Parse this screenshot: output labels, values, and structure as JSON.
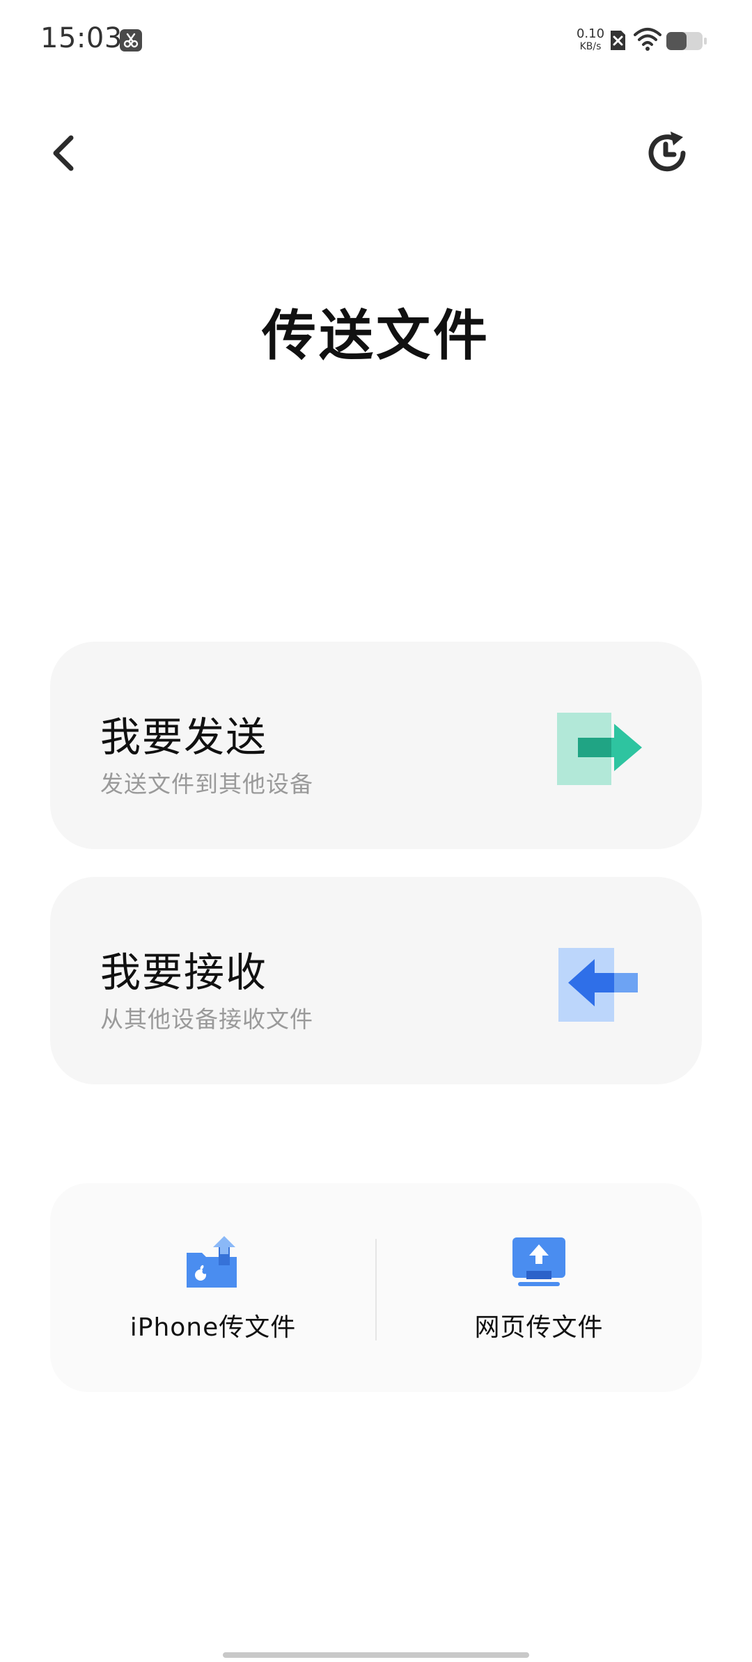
{
  "status_bar": {
    "time": "15:03",
    "network_speed_value": "0.10",
    "network_speed_unit": "KB/s",
    "app_icon": "scissors-icon",
    "sim_icon": "sim-off-icon",
    "wifi_icon": "wifi-icon",
    "battery_icon": "battery-icon",
    "battery_level": 0.55
  },
  "nav": {
    "back_icon": "chevron-left-icon",
    "history_icon": "history-clock-icon"
  },
  "page": {
    "title": "传送文件"
  },
  "actions": [
    {
      "title": "我要发送",
      "subtitle": "发送文件到其他设备",
      "icon": "send-arrow-icon",
      "accent": "#2ec4a0",
      "tint": "#b2e8d8"
    },
    {
      "title": "我要接收",
      "subtitle": "从其他设备接收文件",
      "icon": "receive-arrow-icon",
      "accent": "#2f6fe8",
      "tint": "#bcd6fb"
    }
  ],
  "options": [
    {
      "label": "iPhone传文件",
      "icon": "iphone-folder-icon",
      "accent": "#4a8df0"
    },
    {
      "label": "网页传文件",
      "icon": "web-upload-icon",
      "accent": "#4a8df0"
    }
  ]
}
